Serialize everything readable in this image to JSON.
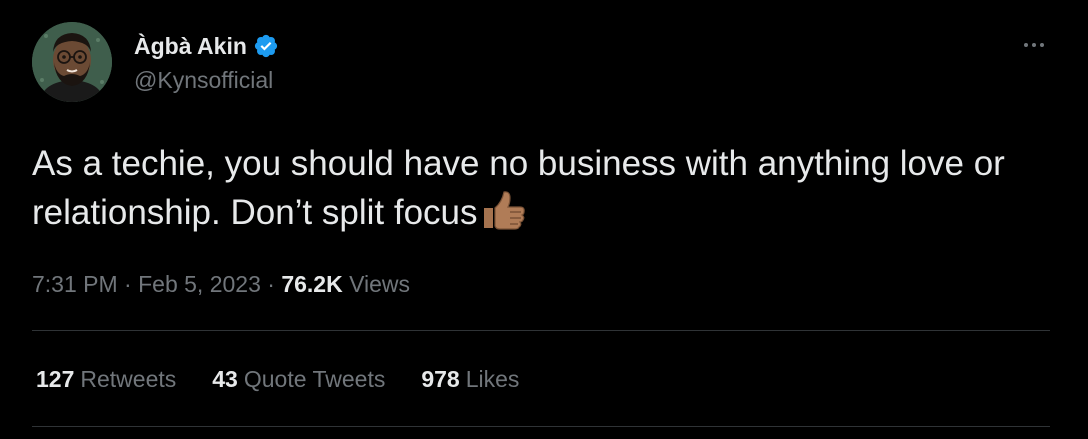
{
  "author": {
    "display_name": "Àgbà Akin",
    "handle": "@Kynsofficial",
    "verified": true
  },
  "tweet": {
    "text": "As a techie, you should have no business with anything love or relationship. Don’t split focus",
    "emoji": "👍🏾"
  },
  "meta": {
    "time": "7:31 PM",
    "separator": "·",
    "date": "Feb 5, 2023",
    "views_count": "76.2K",
    "views_label": "Views"
  },
  "stats": {
    "retweets_count": "127",
    "retweets_label": "Retweets",
    "quote_count": "43",
    "quote_label": "Quote Tweets",
    "likes_count": "978",
    "likes_label": "Likes"
  },
  "colors": {
    "background": "#000000",
    "primary_text": "#e7e9ea",
    "secondary_text": "#71767b",
    "divider": "#2f3336",
    "verified_blue": "#1d9bf0"
  },
  "icons": {
    "verified": "verified-badge-icon",
    "more": "more-options-icon",
    "thumbs_up": "thumbs-up-emoji-icon"
  }
}
